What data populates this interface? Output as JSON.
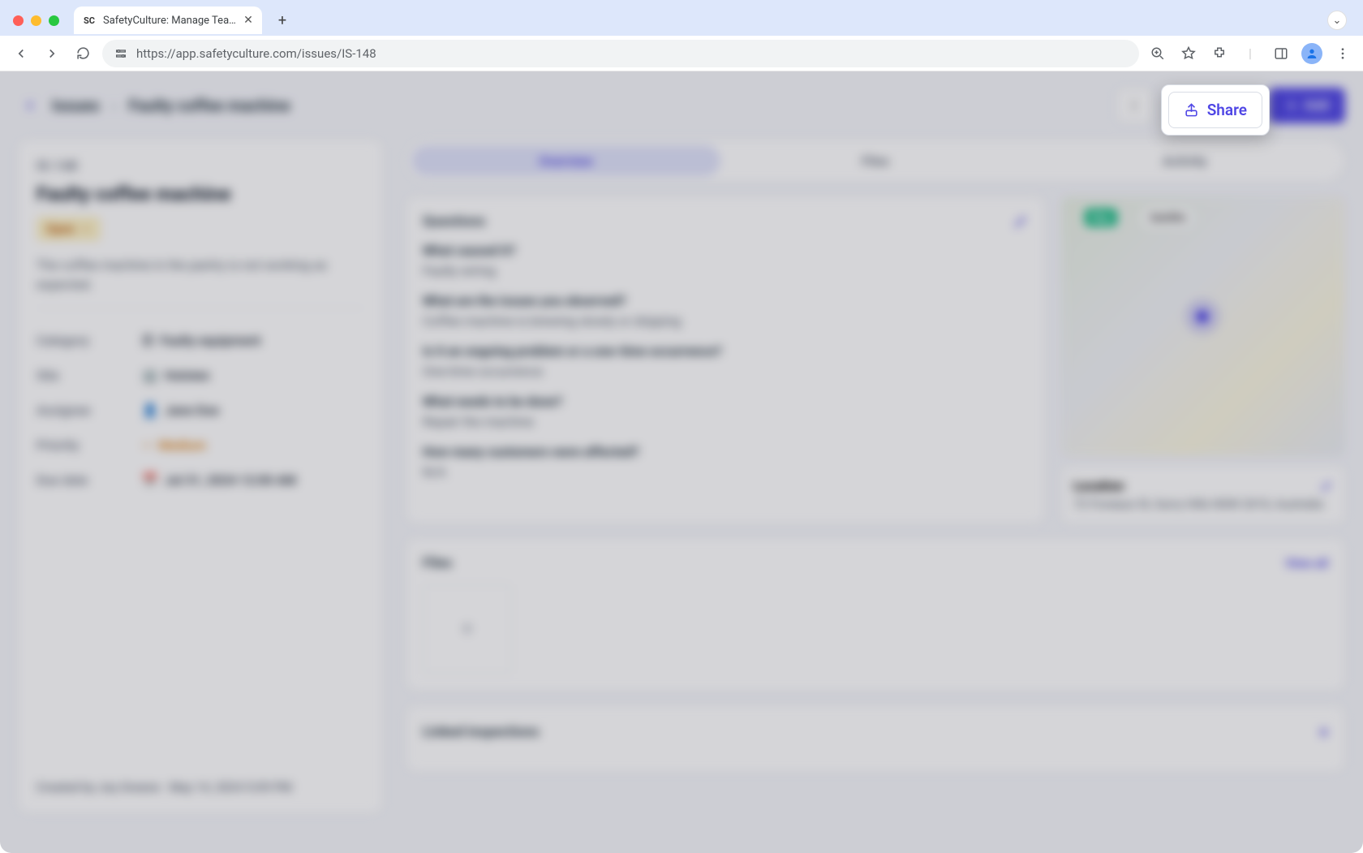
{
  "browser": {
    "tab_title": "SafetyCulture: Manage Teams and...",
    "url": "https://app.safetyculture.com/issues/IS-148"
  },
  "header": {
    "breadcrumb_root": "Issues",
    "breadcrumb_current": "Faulty coffee machine",
    "share_label": "Share",
    "add_label": "Add"
  },
  "sidebar": {
    "issue_id": "IS-148",
    "title": "Faulty coffee machine",
    "status": "Open",
    "description": "The coffee machine in the pantry is not working as expected.",
    "fields": {
      "category_label": "Category",
      "category_value": "Faulty equipment",
      "site_label": "Site",
      "site_value": "Holsten",
      "assignee_label": "Assignee",
      "assignee_value": "Jane Doe",
      "priority_label": "Priority",
      "priority_value": "Medium",
      "due_label": "Due date",
      "due_value": "Jul 31, 2024 12:00 AM"
    },
    "created": "Created by Joy Greene · May 14, 2024 5:09 PM"
  },
  "tabs": {
    "overview": "Overview",
    "files": "Files",
    "activity": "Activity"
  },
  "questions": {
    "heading": "Questions",
    "items": [
      {
        "q": "What caused it?",
        "a": "Faulty wiring"
      },
      {
        "q": "What are the issues you observed?",
        "a": "Coffee machine is brewing slowly or dripping"
      },
      {
        "q": "Is it an ongoing problem or a one-time occurrence?",
        "a": "One-time occurrence"
      },
      {
        "q": "What needs to be done?",
        "a": "Repair the machine"
      },
      {
        "q": "How many customers were affected?",
        "a": "N/A"
      }
    ]
  },
  "map": {
    "chip1": "Map",
    "chip2": "Satellite",
    "location_label": "Location",
    "location_value": "72 Foveaux St, Surry Hills NSW 2010, Australia"
  },
  "files": {
    "heading": "Files",
    "view_all": "View all"
  },
  "linked": {
    "heading": "Linked inspections"
  }
}
